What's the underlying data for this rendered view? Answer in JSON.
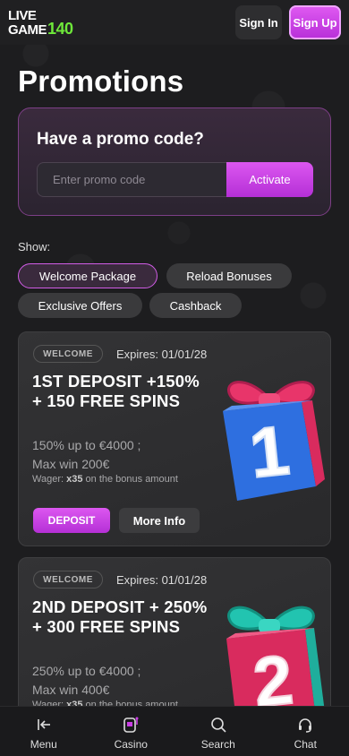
{
  "header": {
    "logo_line1": "LIVE",
    "logo_line2": "GAME",
    "logo_number": "140",
    "sign_in": "Sign In",
    "sign_up": "Sign Up"
  },
  "page": {
    "title": "Promotions"
  },
  "promo": {
    "title": "Have a promo code?",
    "placeholder": "Enter promo code",
    "activate": "Activate"
  },
  "filters": {
    "label": "Show:",
    "items": [
      {
        "label": "Welcome Package",
        "active": true
      },
      {
        "label": "Reload Bonuses",
        "active": false
      },
      {
        "label": "Exclusive Offers",
        "active": false
      },
      {
        "label": "Cashback",
        "active": false
      }
    ]
  },
  "cards": [
    {
      "badge": "WELCOME",
      "expires": "Expires: 01/01/28",
      "title": "1ST DEPOSIT +150% + 150 FREE SPINS",
      "line1": "150% up to €4000 ;",
      "line2": "Max win 200€",
      "wager_prefix": "Wager: ",
      "wager_value": "x35",
      "wager_suffix": " on the bonus amount",
      "deposit": "DEPOSIT",
      "more": "More Info",
      "gift_number": "1"
    },
    {
      "badge": "WELCOME",
      "expires": "Expires: 01/01/28",
      "title": "2ND DEPOSIT + 250% + 300 FREE SPINS",
      "line1": "250% up to €4000 ;",
      "line2": "Max win 400€",
      "wager_prefix": "Wager: ",
      "wager_value": "x35",
      "wager_suffix": " on the bonus amount",
      "gift_number": "2"
    }
  ],
  "nav": [
    {
      "label": "Menu",
      "icon": "menu-arrow-icon"
    },
    {
      "label": "Casino",
      "icon": "slot-machine-icon"
    },
    {
      "label": "Search",
      "icon": "search-icon"
    },
    {
      "label": "Chat",
      "icon": "headset-icon"
    }
  ],
  "colors": {
    "accent": "#c93ee3",
    "brand_green": "#6ee83a",
    "background": "#1d1d1f"
  }
}
